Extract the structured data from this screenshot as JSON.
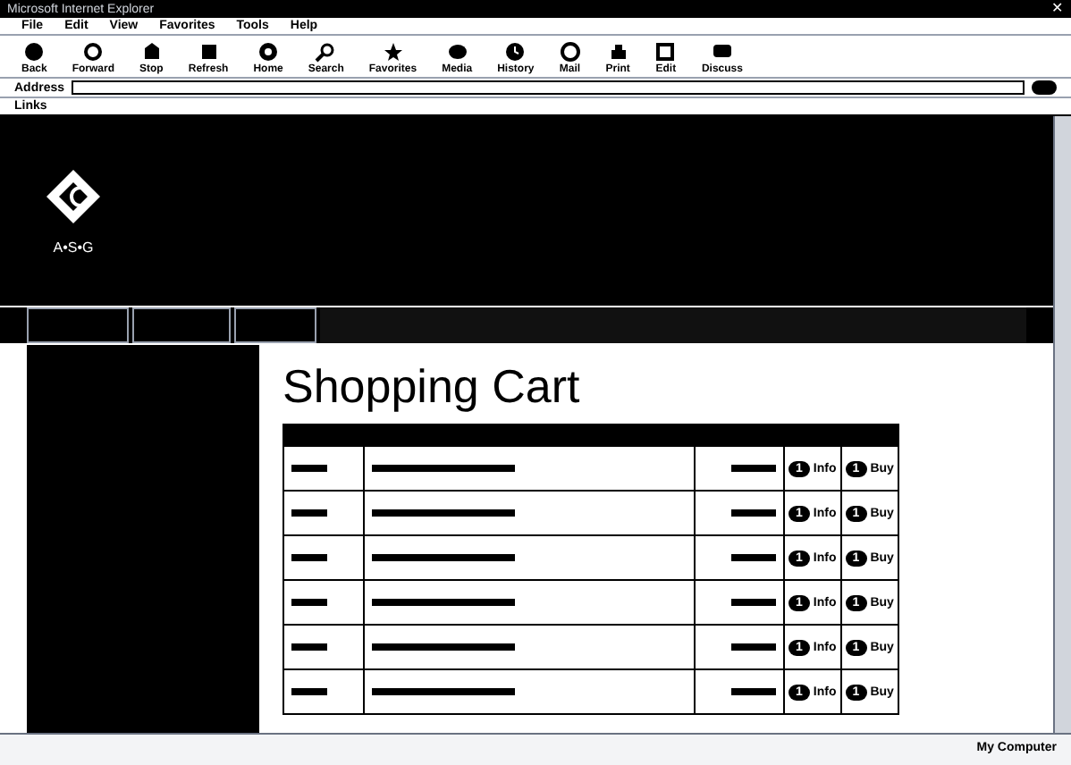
{
  "window": {
    "title": "Microsoft Internet Explorer",
    "close": "✕"
  },
  "menu": [
    "File",
    "Edit",
    "View",
    "Favorites",
    "Tools",
    "Help"
  ],
  "toolbar": [
    "Back",
    "Forward",
    "Stop",
    "Refresh",
    "Home",
    "Search",
    "Favorites",
    "Media",
    "History",
    "Mail",
    "Print",
    "Edit",
    "Discuss"
  ],
  "address": {
    "label": "Address"
  },
  "links": {
    "label": "Links"
  },
  "site": {
    "logo_text": "A•S•G"
  },
  "page": {
    "heading": "Shopping Cart"
  },
  "cart": {
    "rows": [
      {
        "qty_info": "1",
        "info": "Info",
        "qty_buy": "1",
        "buy": "Buy"
      },
      {
        "qty_info": "1",
        "info": "Info",
        "qty_buy": "1",
        "buy": "Buy"
      },
      {
        "qty_info": "1",
        "info": "Info",
        "qty_buy": "1",
        "buy": "Buy"
      },
      {
        "qty_info": "1",
        "info": "Info",
        "qty_buy": "1",
        "buy": "Buy"
      },
      {
        "qty_info": "1",
        "info": "Info",
        "qty_buy": "1",
        "buy": "Buy"
      },
      {
        "qty_info": "1",
        "info": "Info",
        "qty_buy": "1",
        "buy": "Buy"
      }
    ]
  },
  "status_bar": {
    "zone": "My Computer"
  }
}
